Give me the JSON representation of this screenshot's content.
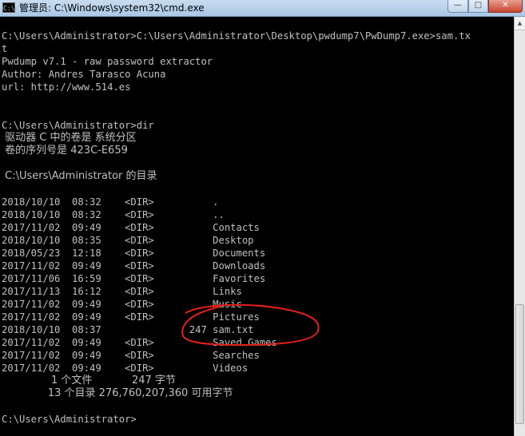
{
  "window": {
    "title": "管理员: C:\\Windows\\system32\\cmd.exe",
    "icon_text": "C:\\",
    "minimize_glyph": "—",
    "maximize_glyph": "□",
    "close_glyph": "✕"
  },
  "console": {
    "lines": [
      "C:\\Users\\Administrator>C:\\Users\\Administrator\\Desktop\\pwdump7\\PwDump7.exe>sam.tx",
      "t",
      "Pwdump v7.1 - raw password extractor",
      "Author: Andres Tarasco Acuna",
      "url: http://www.514.es",
      "",
      "",
      "C:\\Users\\Administrator>dir",
      " 驱动器 C 中的卷是 系统分区",
      " 卷的序列号是 423C-E659",
      "",
      " C:\\Users\\Administrator 的目录",
      "",
      "2018/10/10  08:32    <DIR>          .",
      "2018/10/10  08:32    <DIR>          ..",
      "2017/11/02  09:49    <DIR>          Contacts",
      "2018/10/10  08:35    <DIR>          Desktop",
      "2018/05/23  12:18    <DIR>          Documents",
      "2017/11/02  09:49    <DIR>          Downloads",
      "2017/11/06  16:59    <DIR>          Favorites",
      "2017/11/13  16:12    <DIR>          Links",
      "2017/11/02  09:49    <DIR>          Music",
      "2017/11/02  09:49    <DIR>          Pictures",
      "2018/10/10  08:37               247 sam.txt",
      "2017/11/02  09:49    <DIR>          Saved Games",
      "2017/11/02  09:49    <DIR>          Searches",
      "2017/11/02  09:49    <DIR>          Videos",
      "               1 个文件            247 字节",
      "              13 个目录 276,760,207,360 可用字节",
      "",
      "C:\\Users\\Administrator>"
    ]
  },
  "annotation": {
    "color": "#e8201a"
  }
}
